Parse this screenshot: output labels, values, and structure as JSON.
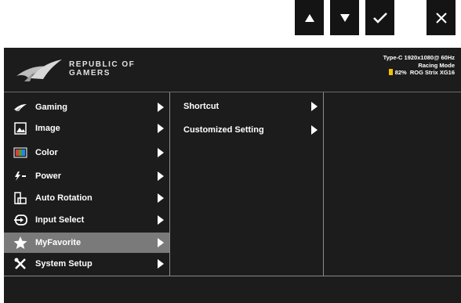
{
  "nav_keys": [
    {
      "name": "up-arrow-button",
      "icon": "triangle-up-icon"
    },
    {
      "name": "down-arrow-button",
      "icon": "triangle-down-icon"
    },
    {
      "name": "confirm-button",
      "icon": "checkmark-icon"
    },
    {
      "name": "close-button",
      "icon": "close-icon"
    }
  ],
  "header": {
    "brand_line1": "REPUBLIC OF",
    "brand_line2": "GAMERS",
    "status_line1": "Type-C  1920x1080@  60Hz",
    "status_line2": "Racing Mode",
    "battery_text": "82%",
    "model": "ROG Strix XG16",
    "battery_color": "#f2c200"
  },
  "menu": {
    "items": [
      {
        "label": "Gaming",
        "icon": "rog-eye-icon"
      },
      {
        "label": "Image",
        "icon": "image-icon"
      },
      {
        "label": "Color",
        "icon": "color-palette-icon"
      },
      {
        "label": "Power",
        "icon": "power-plug-icon"
      },
      {
        "label": "Auto Rotation",
        "icon": "auto-rotation-icon"
      },
      {
        "label": "Input Select",
        "icon": "input-select-icon"
      },
      {
        "label": "MyFavorite",
        "icon": "star-icon",
        "selected": true
      },
      {
        "label": "System Setup",
        "icon": "wrench-screwdriver-icon"
      }
    ]
  },
  "submenu": {
    "items": [
      {
        "label": "Shortcut"
      },
      {
        "label": "Customized Setting"
      }
    ]
  },
  "colors": {
    "osd_background": "#1c1c1c",
    "selected_row": "#7a7a7a",
    "divider": "#8a8a8a"
  }
}
